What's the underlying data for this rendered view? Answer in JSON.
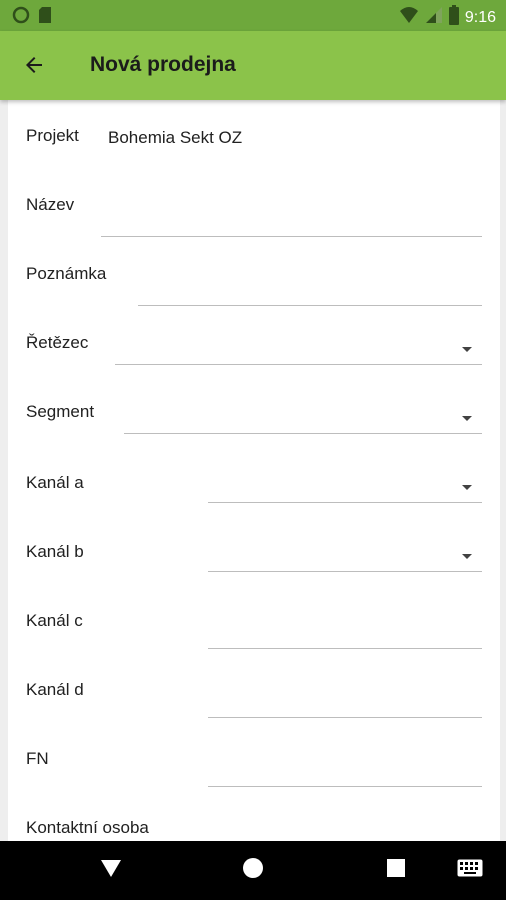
{
  "status_bar": {
    "time": "9:16",
    "icons": [
      "circle-notification-icon",
      "sd-card-icon",
      "wifi-icon",
      "signal-icon",
      "battery-icon"
    ]
  },
  "app_bar": {
    "title": "Nová prodejna",
    "back_icon": "arrow-back-icon",
    "color": "#8bc34a"
  },
  "form": {
    "projekt": {
      "label": "Projekt",
      "value": "Bohemia Sekt OZ"
    },
    "nazev": {
      "label": "Název",
      "value": ""
    },
    "poznamka": {
      "label": "Poznámka",
      "value": ""
    },
    "retezec": {
      "label": "Řetězec",
      "value": ""
    },
    "segment": {
      "label": "Segment",
      "value": ""
    },
    "kanal_a": {
      "label": "Kanál a",
      "value": ""
    },
    "kanal_b": {
      "label": "Kanál b",
      "value": ""
    },
    "kanal_c": {
      "label": "Kanál c",
      "value": ""
    },
    "kanal_d": {
      "label": "Kanál d",
      "value": ""
    },
    "fn": {
      "label": "FN",
      "value": ""
    },
    "kontaktni_osoba": {
      "label": "Kontaktní osoba"
    }
  },
  "nav_bar": {
    "icons": [
      "back-triangle-icon",
      "home-circle-icon",
      "recents-square-icon",
      "keyboard-icon"
    ]
  }
}
